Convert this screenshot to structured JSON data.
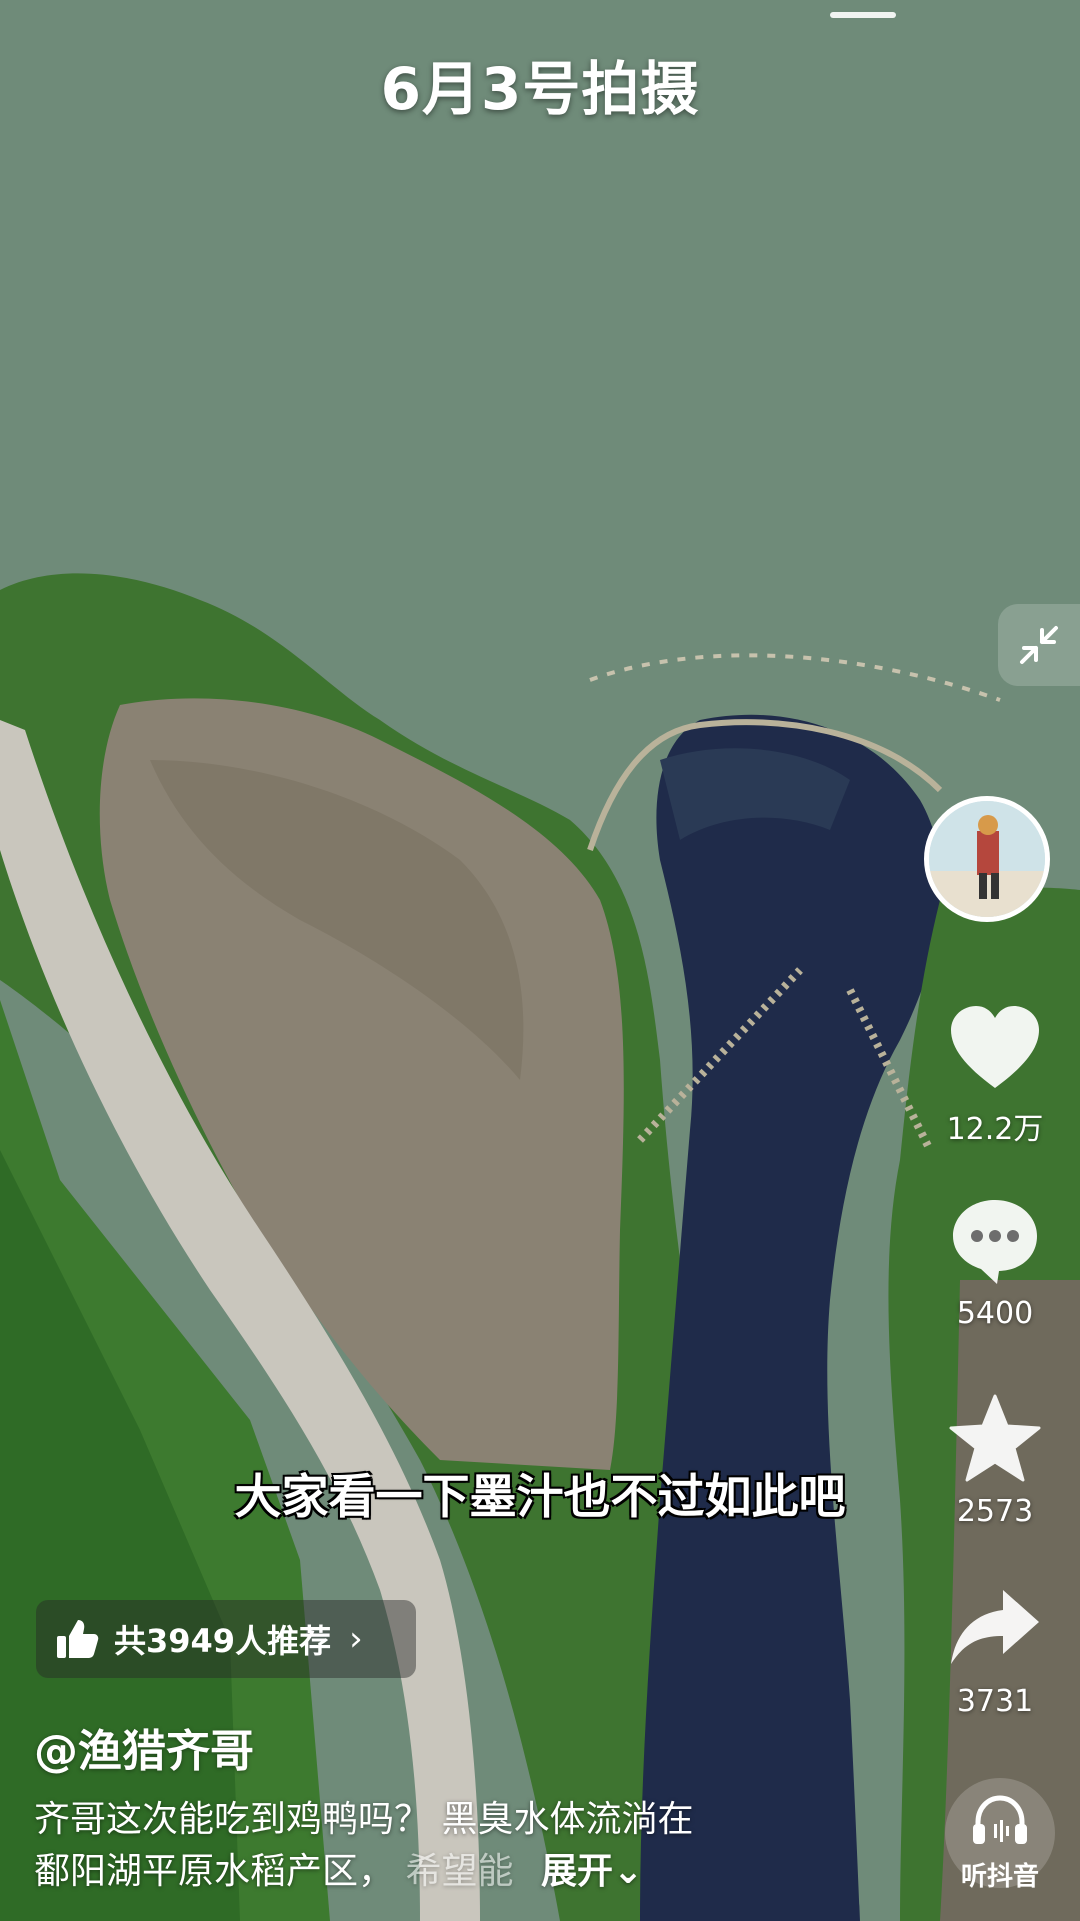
{
  "video": {
    "date_caption": "6月3号拍摄",
    "subtitle": "大家看一下墨汁也不过如此吧"
  },
  "actions": {
    "like_count": "12.2万",
    "comment_count": "5400",
    "favorite_count": "2573",
    "share_count": "3731"
  },
  "recommend": {
    "label": "共3949人推荐",
    "chevron": "›"
  },
  "author": {
    "handle": "@渔猎齐哥"
  },
  "description": {
    "line1": "齐哥这次能吃到鸡鸭吗？ 黑臭水体流淌在",
    "line2": "鄱阳湖平原水稻产区，",
    "line2_fade": "希望能",
    "expand_label": "展开⌄"
  },
  "listen": {
    "label": "听抖音"
  },
  "icons": {
    "collapse": "collapse-arrows-icon",
    "like": "heart-icon",
    "comment": "comment-bubble-icon",
    "favorite": "star-icon",
    "share": "share-arrow-icon",
    "recommend": "thumbs-up-icon",
    "listen": "headphones-icon"
  },
  "colors": {
    "lake": "#6f8b79",
    "dark_water": "#1f2b4a",
    "field": "#8a8273",
    "grass": "#3f7a33"
  }
}
